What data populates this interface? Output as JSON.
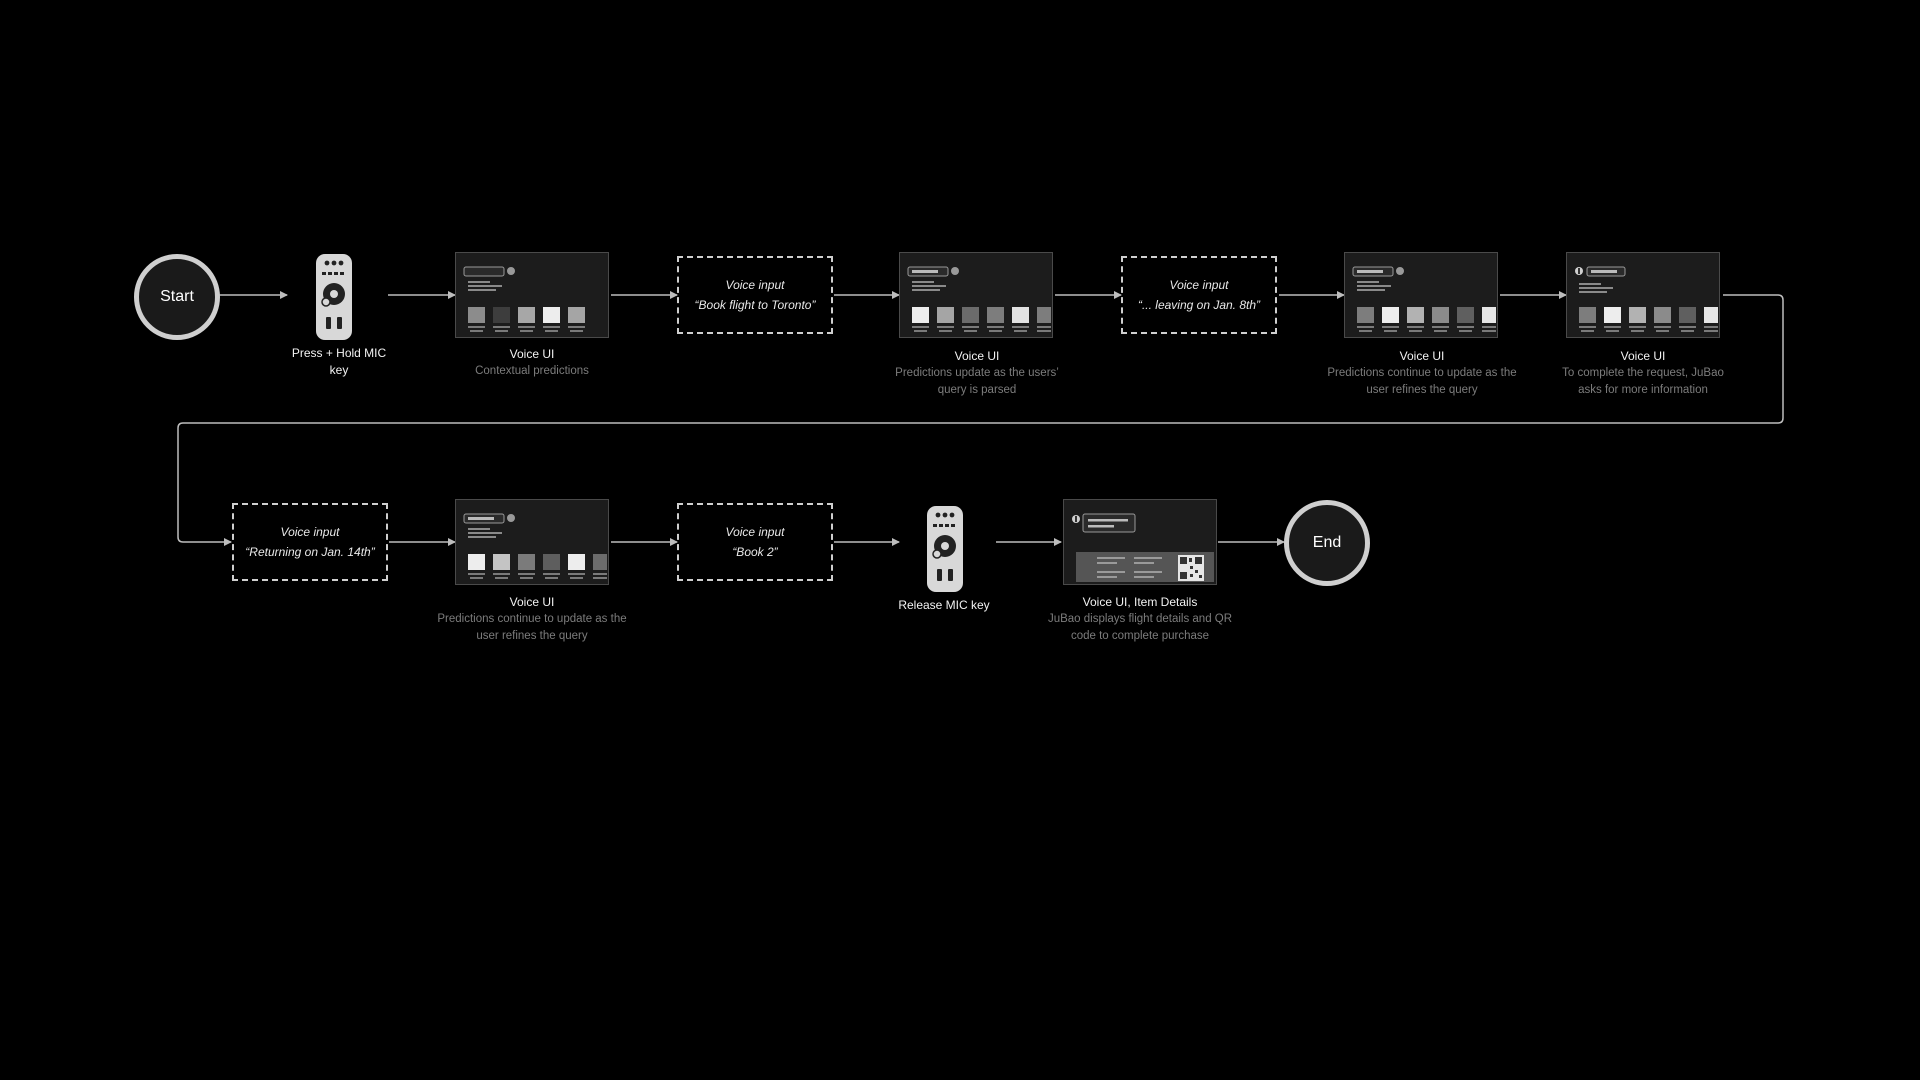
{
  "colors": {
    "background": "#000000",
    "line": "#bdbdbd",
    "node_border": "#cfcfcf",
    "screen_bg": "#1c1c1c",
    "subtitle": "#7c7c7c"
  },
  "nodes": {
    "start": {
      "label": "Start"
    },
    "remote_press": {
      "icon": "remote-control-icon",
      "title": "Press + Hold MIC key"
    },
    "voice_ui_1": {
      "title": "Voice UI",
      "subtitle": "Contextual predictions"
    },
    "voice_input_1": {
      "line1": "Voice input",
      "line2": "“Book flight to Toronto”"
    },
    "voice_ui_2": {
      "title": "Voice UI",
      "subtitle": "Predictions update as the users’ query is parsed"
    },
    "voice_input_2": {
      "line1": "Voice input",
      "line2": "“... leaving on Jan. 8th”"
    },
    "voice_ui_3": {
      "title": "Voice UI",
      "subtitle": "Predictions continue to update as the user refines the query"
    },
    "voice_ui_4": {
      "title": "Voice UI",
      "subtitle": "To complete the request, JuBao asks for more information"
    },
    "voice_input_3": {
      "line1": "Voice input",
      "line2": "“Returning on Jan. 14th”"
    },
    "voice_ui_5": {
      "title": "Voice UI",
      "subtitle": "Predictions continue to update as the user refines the query"
    },
    "voice_input_4": {
      "line1": "Voice input",
      "line2": "“Book 2”"
    },
    "remote_release": {
      "icon": "remote-control-icon",
      "title": "Release MIC key"
    },
    "voice_ui_details": {
      "title": "Voice UI, Item Details",
      "subtitle": "JuBao displays flight details and QR code to complete purchase"
    },
    "end": {
      "label": "End"
    }
  }
}
